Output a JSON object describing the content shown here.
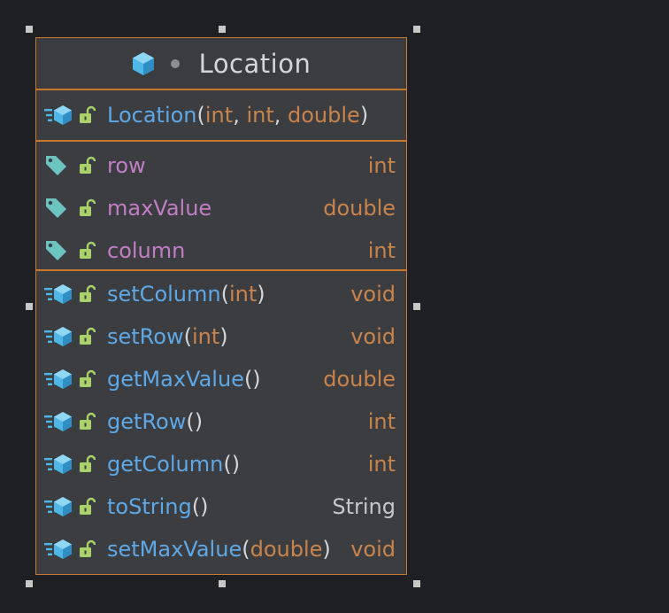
{
  "class": {
    "name": "Location",
    "constructor": {
      "name": "Location",
      "params": [
        "int",
        "int",
        "double"
      ]
    },
    "fields": [
      {
        "name": "row",
        "type": "int"
      },
      {
        "name": "maxValue",
        "type": "double"
      },
      {
        "name": "column",
        "type": "int"
      }
    ],
    "methods": [
      {
        "name": "setColumn",
        "params": [
          "int"
        ],
        "type": "void"
      },
      {
        "name": "setRow",
        "params": [
          "int"
        ],
        "type": "void"
      },
      {
        "name": "getMaxValue",
        "params": [],
        "type": "double"
      },
      {
        "name": "getRow",
        "params": [],
        "type": "int"
      },
      {
        "name": "getColumn",
        "params": [],
        "type": "int"
      },
      {
        "name": "toString",
        "params": [],
        "type": "String"
      },
      {
        "name": "setMaxValue",
        "params": [
          "double"
        ],
        "type": "void"
      }
    ]
  },
  "colors": {
    "background": "#1f2023",
    "border": "#c9792e",
    "name": "#5fa8e6",
    "field": "#c27ec4",
    "type": "#c9844c",
    "icon_class": "#4fb6e8",
    "icon_field": "#6cc4c0",
    "icon_access": "#a9d36a"
  },
  "icons": {
    "class": "class-icon",
    "method": "method-icon",
    "field": "field-icon",
    "access": "public-lock-icon"
  }
}
